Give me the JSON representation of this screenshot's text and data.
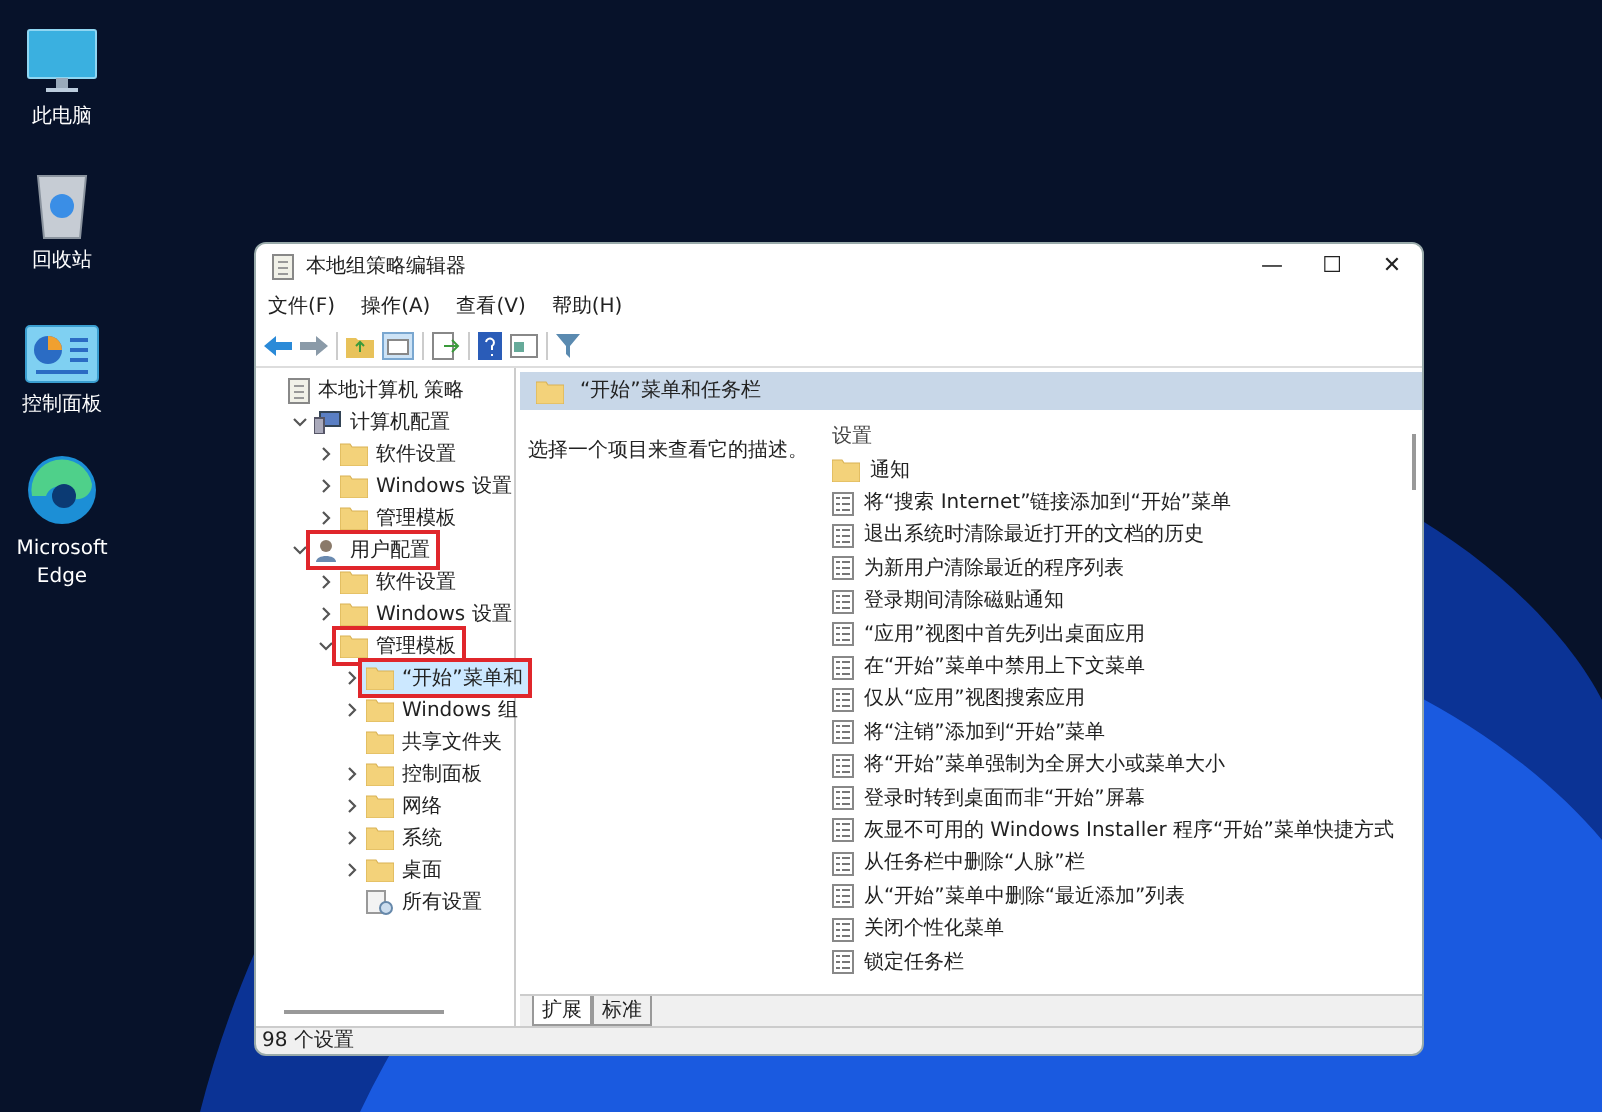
{
  "desktop_icons": [
    {
      "kind": "monitor",
      "label": "此电脑"
    },
    {
      "kind": "recycle",
      "label": "回收站"
    },
    {
      "kind": "control",
      "label": "控制面板"
    },
    {
      "kind": "edge",
      "label": "Microsoft Edge"
    }
  ],
  "window": {
    "title": "本地组策略编辑器",
    "controls": [
      "—",
      "☐",
      "✕"
    ]
  },
  "menu": [
    "文件(F)",
    "操作(A)",
    "查看(V)",
    "帮助(H)"
  ],
  "tree": [
    {
      "label": "本地计算机 策略",
      "kind": "policy-root",
      "selected": false,
      "highlighted": false,
      "children": [
        {
          "label": "计算机配置",
          "kind": "computer",
          "expanded": true,
          "selected": false,
          "highlighted": false,
          "children": [
            {
              "label": "软件设置",
              "kind": "folder",
              "expanded": false,
              "selected": false,
              "highlighted": false
            },
            {
              "label": "Windows 设置",
              "kind": "folder",
              "expanded": false,
              "selected": false,
              "highlighted": false
            },
            {
              "label": "管理模板",
              "kind": "folder",
              "expanded": false,
              "selected": false,
              "highlighted": false
            }
          ]
        },
        {
          "label": "用户配置",
          "kind": "user",
          "expanded": true,
          "selected": false,
          "highlighted": true,
          "children": [
            {
              "label": "软件设置",
              "kind": "folder",
              "expanded": false,
              "selected": false,
              "highlighted": false
            },
            {
              "label": "Windows 设置",
              "kind": "folder",
              "expanded": false,
              "selected": false,
              "highlighted": false
            },
            {
              "label": "管理模板",
              "kind": "folder",
              "expanded": true,
              "selected": false,
              "highlighted": true,
              "children": [
                {
                  "label": "“开始”菜单和",
                  "kind": "folder",
                  "expanded": false,
                  "selected": true,
                  "highlighted": true
                },
                {
                  "label": "Windows 组",
                  "kind": "folder",
                  "expanded": false,
                  "selected": false,
                  "highlighted": false
                },
                {
                  "label": "共享文件夹",
                  "kind": "folder",
                  "selected": false,
                  "highlighted": false
                },
                {
                  "label": "控制面板",
                  "kind": "folder",
                  "expanded": false,
                  "selected": false,
                  "highlighted": false
                },
                {
                  "label": "网络",
                  "kind": "folder",
                  "expanded": false,
                  "selected": false,
                  "highlighted": false
                },
                {
                  "label": "系统",
                  "kind": "folder",
                  "expanded": false,
                  "selected": false,
                  "highlighted": false
                },
                {
                  "label": "桌面",
                  "kind": "folder",
                  "expanded": false,
                  "selected": false,
                  "highlighted": false
                },
                {
                  "label": "所有设置",
                  "kind": "settings",
                  "selected": false,
                  "highlighted": false
                }
              ]
            }
          ]
        }
      ]
    }
  ],
  "detail": {
    "title": "“开始”菜单和任务栏",
    "description": "选择一个项目来查看它的描述。",
    "column": "设置",
    "items": [
      {
        "kind": "folder",
        "label": "通知"
      },
      {
        "kind": "policy",
        "label": "将“搜索 Internet”链接添加到“开始”菜单"
      },
      {
        "kind": "policy",
        "label": "退出系统时清除最近打开的文档的历史"
      },
      {
        "kind": "policy",
        "label": "为新用户清除最近的程序列表"
      },
      {
        "kind": "policy",
        "label": "登录期间清除磁贴通知"
      },
      {
        "kind": "policy",
        "label": "“应用”视图中首先列出桌面应用"
      },
      {
        "kind": "policy",
        "label": "在“开始”菜单中禁用上下文菜单"
      },
      {
        "kind": "policy",
        "label": "仅从“应用”视图搜索应用"
      },
      {
        "kind": "policy",
        "label": "将“注销”添加到“开始”菜单"
      },
      {
        "kind": "policy",
        "label": "将“开始”菜单强制为全屏大小或菜单大小"
      },
      {
        "kind": "policy",
        "label": "登录时转到桌面而非“开始”屏幕"
      },
      {
        "kind": "policy",
        "label": "灰显不可用的 Windows Installer 程序“开始”菜单快捷方式"
      },
      {
        "kind": "policy",
        "label": "从任务栏中删除“人脉”栏"
      },
      {
        "kind": "policy",
        "label": "从“开始”菜单中删除“最近添加”列表"
      },
      {
        "kind": "policy",
        "label": "关闭个性化菜单"
      },
      {
        "kind": "policy",
        "label": "锁定任务栏"
      }
    ],
    "tabs": [
      {
        "label": "扩展",
        "selected": true
      },
      {
        "label": "标准",
        "selected": false
      }
    ]
  },
  "status_bar": "98 个设置"
}
